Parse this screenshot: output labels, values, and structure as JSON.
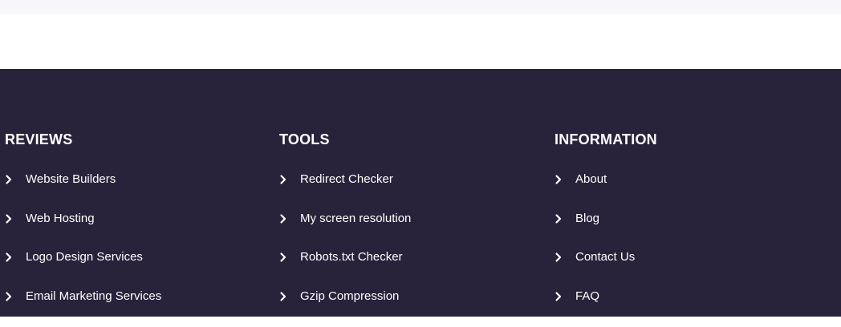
{
  "footer": {
    "columns": [
      {
        "heading": "REVIEWS",
        "links": [
          "Website Builders",
          "Web Hosting",
          "Logo Design Services",
          "Email Marketing Services"
        ]
      },
      {
        "heading": "TOOLS",
        "links": [
          "Redirect Checker",
          "My screen resolution",
          "Robots.txt Checker",
          "Gzip Compression"
        ]
      },
      {
        "heading": "INFORMATION",
        "links": [
          "About",
          "Blog",
          "Contact Us",
          "FAQ"
        ]
      }
    ],
    "link_icon": "chevron-right-icon"
  },
  "colors": {
    "footer_background": "#28233a",
    "top_strip": "#f6f6fb",
    "text": "#ffffff"
  }
}
